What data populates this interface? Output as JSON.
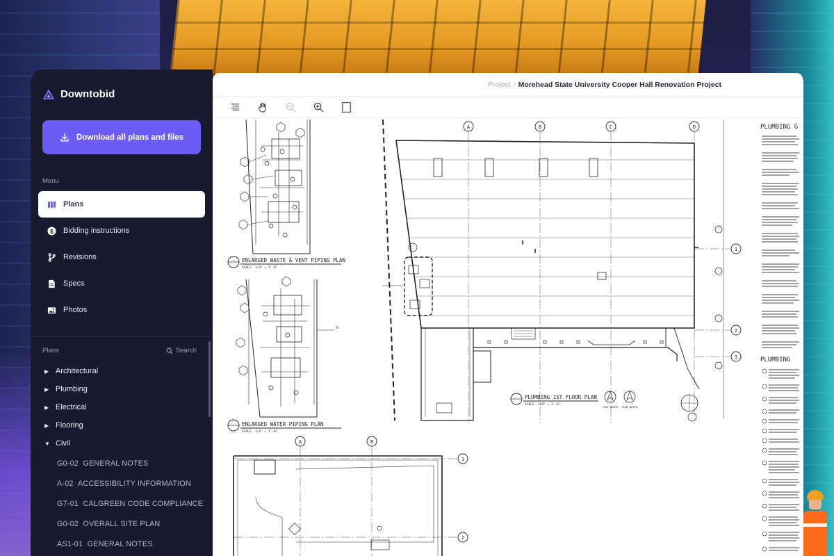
{
  "brand": {
    "name": "Downtobid"
  },
  "download_button": {
    "label": "Download all plans and files"
  },
  "menu": {
    "label": "Menu",
    "items": [
      {
        "label": "Plans",
        "icon": "map-icon",
        "active": true
      },
      {
        "label": "Bidding instructions",
        "icon": "dollar-icon",
        "active": false
      },
      {
        "label": "Revisions",
        "icon": "branch-icon",
        "active": false
      },
      {
        "label": "Specs",
        "icon": "document-icon",
        "active": false
      },
      {
        "label": "Photos",
        "icon": "image-icon",
        "active": false
      }
    ]
  },
  "plans": {
    "label": "Plans",
    "search_label": "Search",
    "categories": [
      {
        "label": "Architectural",
        "expanded": false
      },
      {
        "label": "Plumbing",
        "expanded": false
      },
      {
        "label": "Electrical",
        "expanded": false
      },
      {
        "label": "Flooring",
        "expanded": false
      },
      {
        "label": "Civil",
        "expanded": true
      }
    ],
    "sheets": [
      {
        "code": "G0-02",
        "name": "GENERAL NOTES"
      },
      {
        "code": "A-02",
        "name": "ACCESSIBILITY INFORMATION"
      },
      {
        "code": "G7-01",
        "name": "CALGREEN CODE COMPLIANCE"
      },
      {
        "code": "G0-02",
        "name": "OVERALL SITE PLAN"
      },
      {
        "code": "AS1-01",
        "name": "GENERAL NOTES"
      }
    ]
  },
  "viewer": {
    "breadcrumb_root": "Project",
    "breadcrumb_separator": "/",
    "project_title": "Morehead State University Cooper Hall Renovation Project",
    "tools": [
      "list-icon",
      "hand-icon",
      "zoom-out-icon",
      "zoom-in-icon",
      "fit-page-icon"
    ]
  },
  "drawing": {
    "title_waste": "ENLARGED WASTE & VENT PIPING PLAN",
    "title_water": "ENLARGED WATER PIPING PLAN",
    "title_floor": "PLUMBING 1ST FLOOR PLAN",
    "scale": "SCALE: 1/4\" = 1'-0\"",
    "scale_floor": "SCALE: 1/8\" = 1'-0\"",
    "notes_heading_1": "PLUMBING G",
    "notes_heading_2": "PLUMBING",
    "north_labels": [
      "TRUE NORTH",
      "PLAN NORTH"
    ],
    "grid_top": [
      "A",
      "B",
      "C",
      "D"
    ],
    "grid_side": [
      "1",
      "2",
      "3"
    ],
    "grid_bottom_top": [
      "A",
      "B"
    ],
    "grid_bottom_side": [
      "1",
      "2"
    ]
  },
  "colors": {
    "brand_purple": "#6b5cf6",
    "sidebar_bg": "#1a1a2e",
    "active_item_bg": "#ffffff"
  }
}
